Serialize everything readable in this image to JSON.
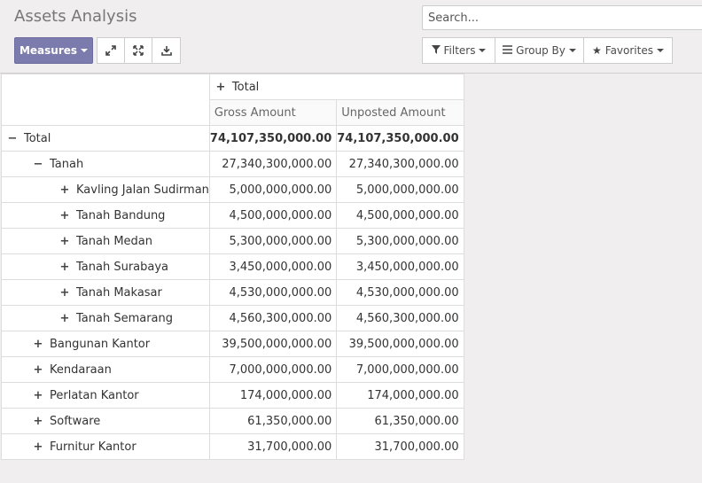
{
  "page": {
    "title": "Assets Analysis"
  },
  "toolbar": {
    "measures_label": "Measures",
    "expand_icon": "expand-arrows-icon",
    "flip_icon": "flip-axis-icon",
    "download_icon": "download-icon"
  },
  "search": {
    "placeholder": "Search...",
    "filters_label": "Filters",
    "group_by_label": "Group By",
    "favorites_label": "Favorites"
  },
  "pivot": {
    "column_header": "Total",
    "measures": [
      "Gross Amount",
      "Unposted Amount"
    ],
    "rows": [
      {
        "label": "Total",
        "level": 0,
        "toggle": "−",
        "gross": "74,107,350,000.00",
        "unposted": "74,107,350,000.00",
        "bold": true
      },
      {
        "label": "Tanah",
        "level": 1,
        "toggle": "−",
        "gross": "27,340,300,000.00",
        "unposted": "27,340,300,000.00"
      },
      {
        "label": "Kavling Jalan Sudirman",
        "level": 2,
        "toggle": "+",
        "gross": "5,000,000,000.00",
        "unposted": "5,000,000,000.00"
      },
      {
        "label": "Tanah Bandung",
        "level": 2,
        "toggle": "+",
        "gross": "4,500,000,000.00",
        "unposted": "4,500,000,000.00"
      },
      {
        "label": "Tanah Medan",
        "level": 2,
        "toggle": "+",
        "gross": "5,300,000,000.00",
        "unposted": "5,300,000,000.00"
      },
      {
        "label": "Tanah Surabaya",
        "level": 2,
        "toggle": "+",
        "gross": "3,450,000,000.00",
        "unposted": "3,450,000,000.00"
      },
      {
        "label": "Tanah Makasar",
        "level": 2,
        "toggle": "+",
        "gross": "4,530,000,000.00",
        "unposted": "4,530,000,000.00"
      },
      {
        "label": "Tanah Semarang",
        "level": 2,
        "toggle": "+",
        "gross": "4,560,300,000.00",
        "unposted": "4,560,300,000.00"
      },
      {
        "label": "Bangunan Kantor",
        "level": 1,
        "toggle": "+",
        "gross": "39,500,000,000.00",
        "unposted": "39,500,000,000.00"
      },
      {
        "label": "Kendaraan",
        "level": 1,
        "toggle": "+",
        "gross": "7,000,000,000.00",
        "unposted": "7,000,000,000.00"
      },
      {
        "label": "Perlatan Kantor",
        "level": 1,
        "toggle": "+",
        "gross": "174,000,000.00",
        "unposted": "174,000,000.00"
      },
      {
        "label": "Software",
        "level": 1,
        "toggle": "+",
        "gross": "61,350,000.00",
        "unposted": "61,350,000.00"
      },
      {
        "label": "Furnitur Kantor",
        "level": 1,
        "toggle": "+",
        "gross": "31,700,000.00",
        "unposted": "31,700,000.00"
      }
    ]
  },
  "colors": {
    "primary": "#7c7bad",
    "background": "#f0eeee",
    "border": "#dddddd"
  }
}
